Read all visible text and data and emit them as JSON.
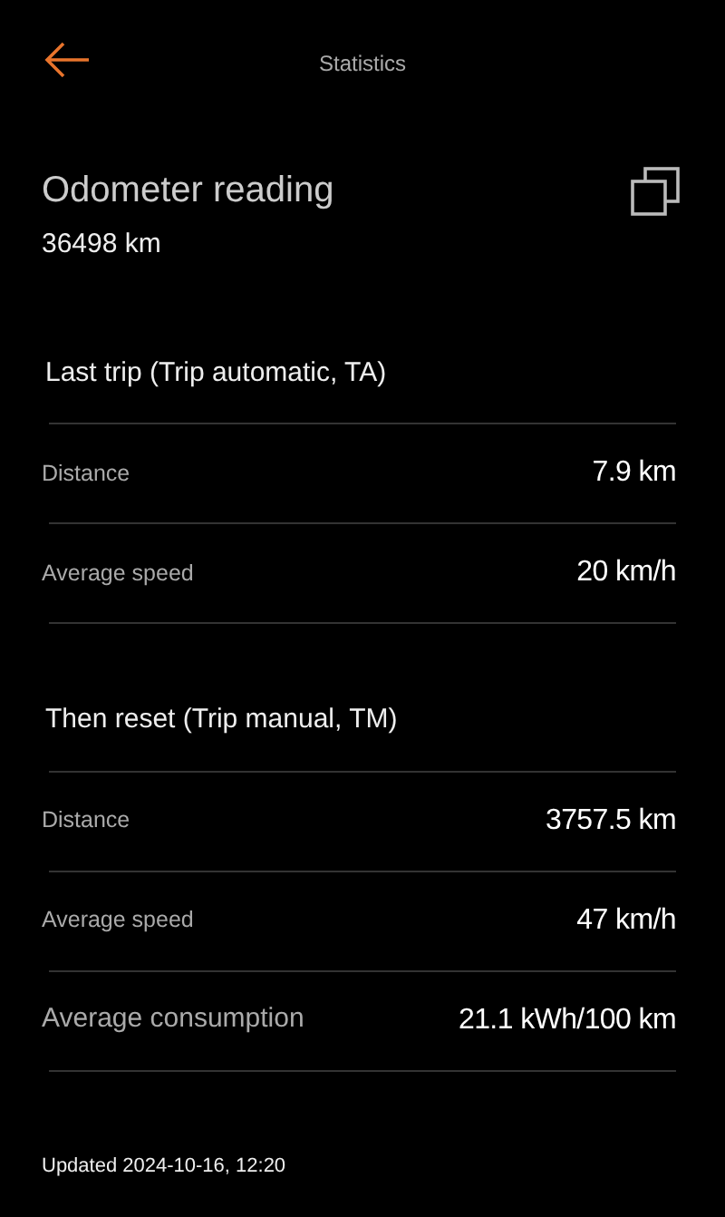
{
  "header": {
    "title": "Statistics"
  },
  "odometer": {
    "title": "Odometer reading",
    "value": "36498 km"
  },
  "sections": [
    {
      "title": "Last trip (Trip automatic, TA)",
      "rows": [
        {
          "kind": "minor",
          "label": "Distance",
          "value": "7.9 km"
        },
        {
          "kind": "minor",
          "label": "Average speed",
          "value": "20 km/h"
        }
      ]
    },
    {
      "title": "Then reset (Trip manual, TM)",
      "rows": [
        {
          "kind": "minor",
          "label": "Distance",
          "value": "3757.5 km"
        },
        {
          "kind": "minor",
          "label": "Average speed",
          "value": "47 km/h"
        },
        {
          "kind": "major",
          "label": "Average consumption",
          "value": "21.1 kWh/100 km"
        }
      ]
    }
  ],
  "footer": "Updated 2024-10-16, 12:20"
}
